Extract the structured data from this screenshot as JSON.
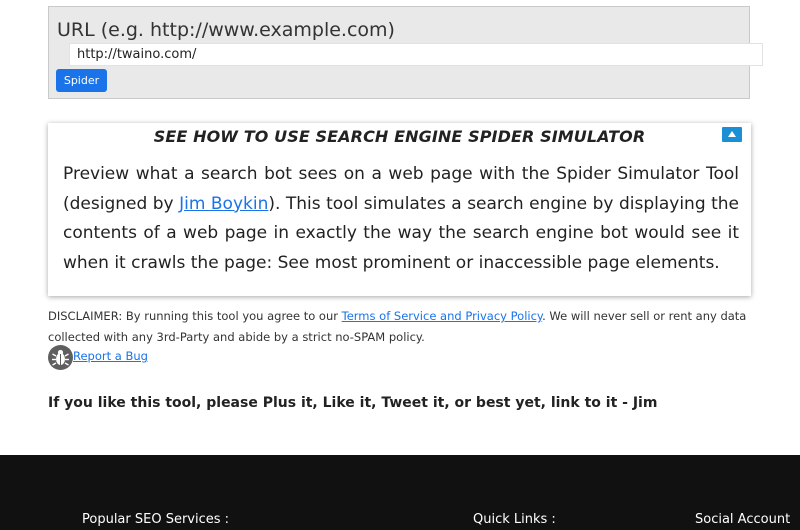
{
  "form": {
    "label": "URL (e.g. http://www.example.com)",
    "url_value": "http://twaino.com/",
    "submit_label": "Spider"
  },
  "info": {
    "title": "SEE HOW TO USE SEARCH ENGINE SPIDER SIMULATOR",
    "text_before_link": "Preview what a search bot sees on a web page with the Spider Simulator Tool (designed by ",
    "link_text": "Jim Boykin",
    "text_after_link": "). This tool simulates a search engine by displaying the contents of a web page in exactly the way the search engine bot would see it when it crawls the page: See most prominent or inaccessible page elements."
  },
  "disclaimer": {
    "prefix": "DISCLAIMER: By running this tool you agree to our ",
    "link_text": "Terms of Service and Privacy Policy",
    "suffix": ". We will never sell or rent any data collected with any 3rd-Party and abide by a strict no-SPAM policy."
  },
  "bug": {
    "icon": "bug-icon",
    "link_text": "Report a Bug"
  },
  "share_text": "If you like this tool, please Plus it, Like it, Tweet it, or best yet, link to it - Jim",
  "footer": {
    "col1_heading": "Popular SEO Services :",
    "col2_heading": "Quick Links :",
    "col3_heading": "Social Account"
  },
  "colors": {
    "primary_button": "#1a73e8",
    "collapse_button": "#1a8fd6",
    "footer_bg": "#111111"
  }
}
